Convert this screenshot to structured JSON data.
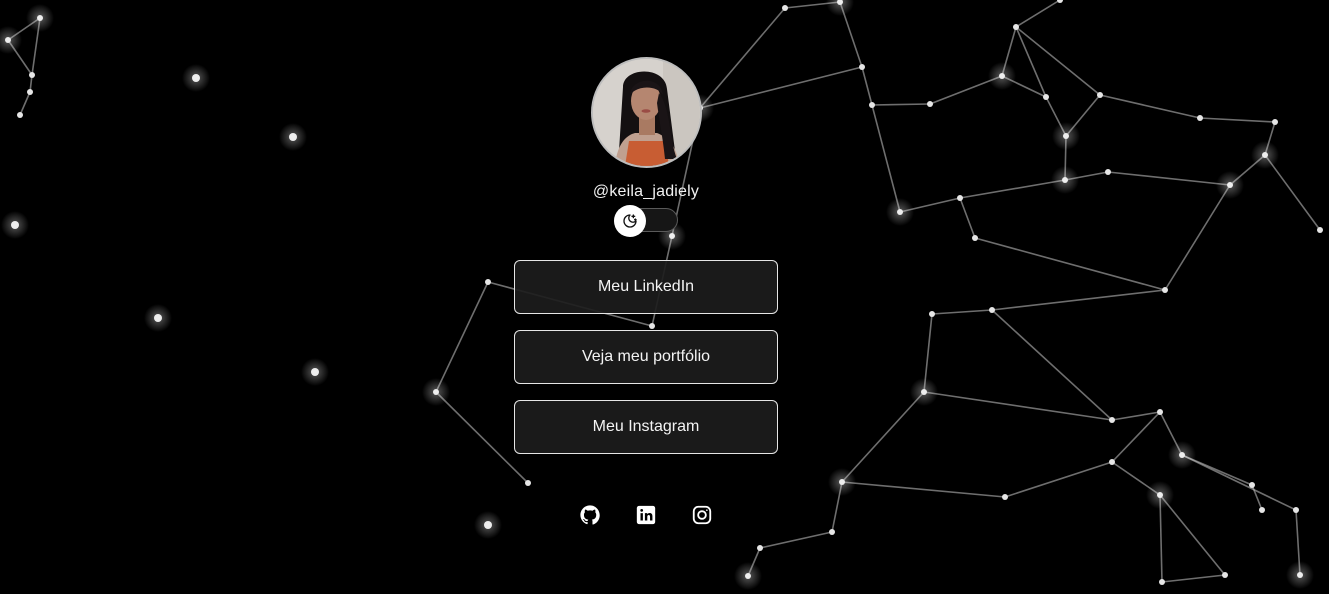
{
  "profile": {
    "username": "@keila_jadiely",
    "avatar_alt": "profile photo"
  },
  "theme_toggle": {
    "icon": "moon-stars-icon",
    "state": "dark"
  },
  "links": {
    "linkedin_label": "Meu LinkedIn",
    "portfolio_label": "Veja meu portfólio",
    "instagram_label": "Meu Instagram"
  },
  "social": {
    "icons": [
      "github-icon",
      "linkedin-icon",
      "instagram-icon"
    ]
  },
  "colors": {
    "background": "#000000",
    "button_bg": "#1c1c1c",
    "button_border": "#e6e6e6",
    "text": "#f4f4f4",
    "network_lines": "#bfbfbf"
  }
}
